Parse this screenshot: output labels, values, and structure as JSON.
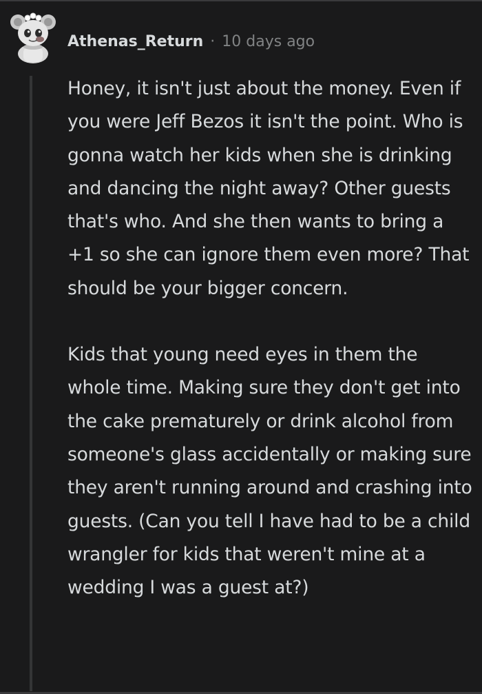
{
  "comment": {
    "author": "Athenas_Return",
    "separator": "·",
    "timestamp": "10 days ago",
    "avatar_icon": "snoo-avatar-icon",
    "paragraphs": [
      "Honey, it isn't just about the money. Even if you were Jeff Bezos it isn't the point. Who is gonna watch her kids when she is drinking and dancing the night away? Other guests that's who. And she then wants to bring a +1 so she can ignore them even more? That should be your bigger concern.",
      "Kids that young need eyes in them the whole time. Making sure they don't get into the cake prematurely or drink alcohol from someone's glass accidentally or making sure they aren't running around and crashing into guests. (Can you tell I have had to be a child wrangler for kids that weren't mine at a wedding I was a guest at?)"
    ]
  },
  "colors": {
    "background": "#1a1a1b",
    "text": "#d7dadc",
    "meta_text": "#818384",
    "thread_line": "#343536"
  }
}
